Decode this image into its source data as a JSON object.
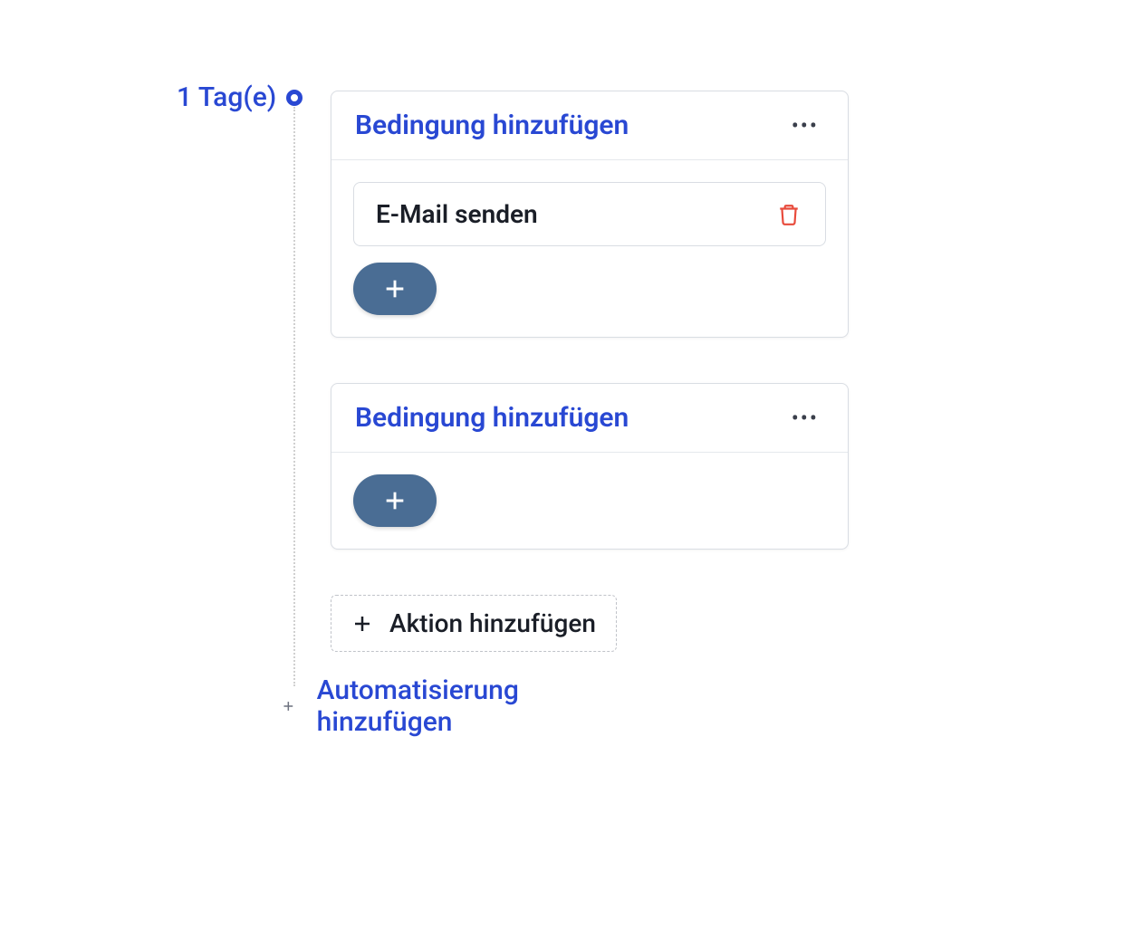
{
  "timeline": {
    "day_label": "1 Tag(e)"
  },
  "conditions": [
    {
      "title": "Bedingung hinzufügen",
      "actions": [
        {
          "label": "E-Mail senden"
        }
      ]
    },
    {
      "title": "Bedingung hinzufügen",
      "actions": []
    }
  ],
  "add_action_label": "Aktion hinzufügen",
  "add_automation_label": "Automatisierung hinzufügen"
}
